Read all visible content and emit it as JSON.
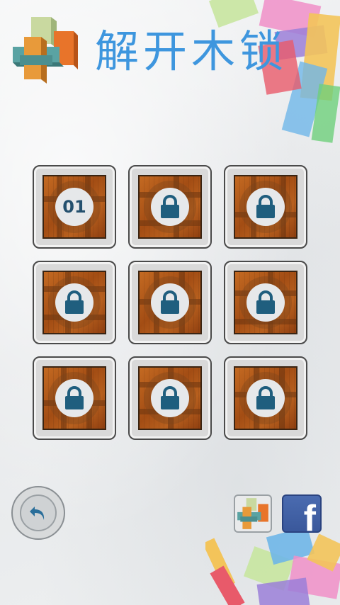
{
  "header": {
    "title": "解开木锁",
    "logo_icon": "wooden-puzzle-logo-icon",
    "title_color": "#3e96de"
  },
  "levels": {
    "items": [
      {
        "label": "01",
        "locked": false
      },
      {
        "label": "",
        "locked": true
      },
      {
        "label": "",
        "locked": true
      },
      {
        "label": "",
        "locked": true
      },
      {
        "label": "",
        "locked": true
      },
      {
        "label": "",
        "locked": true
      },
      {
        "label": "",
        "locked": true
      },
      {
        "label": "",
        "locked": true
      },
      {
        "label": "",
        "locked": true
      }
    ],
    "lock_icon": "lock-icon",
    "lock_color": "#1f5e7e"
  },
  "footer": {
    "back_icon": "back-arrow-icon",
    "app_icon": "wooden-puzzle-app-icon",
    "facebook_icon": "facebook-icon",
    "facebook_letter": "f"
  }
}
